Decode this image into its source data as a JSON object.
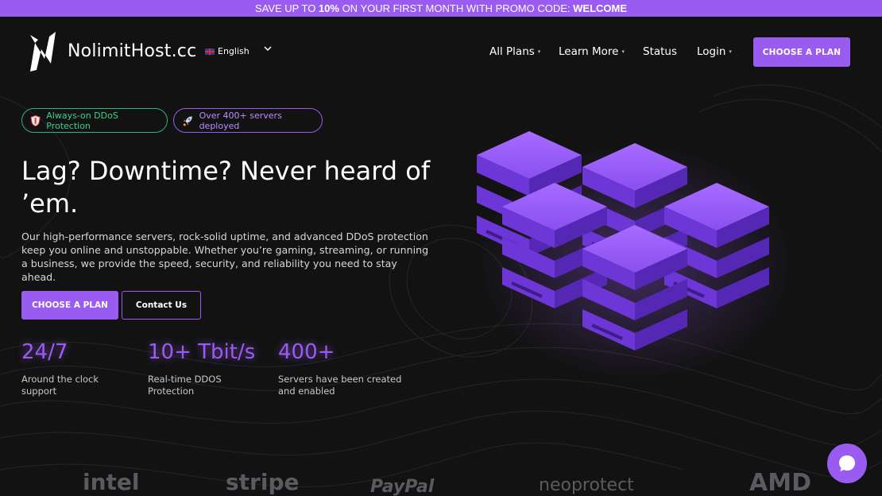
{
  "promo": {
    "prefix": "SAVE UP TO ",
    "discount": "10%",
    "middle": " ON YOUR FIRST MONTH WITH PROMO CODE: ",
    "code": "WELCOME"
  },
  "brand": {
    "name": "NolimitHost.cc"
  },
  "language": {
    "selected": "English"
  },
  "nav": {
    "items": [
      {
        "label": "All Plans",
        "has_dropdown": true
      },
      {
        "label": "Learn More",
        "has_dropdown": true
      },
      {
        "label": "Status",
        "has_dropdown": false
      },
      {
        "label": "Login",
        "has_dropdown": true
      }
    ],
    "cta": "CHOOSE A PLAN"
  },
  "badges": [
    {
      "label": "Always-on DDoS Protection",
      "icon": "shield-icon",
      "color": "#3ed08c"
    },
    {
      "label": "Over 400+ servers deployed",
      "icon": "rocket-icon",
      "color": "#b98cff"
    }
  ],
  "hero": {
    "headline": "Lag? Downtime? Never heard of ’em.",
    "description": "Our high-performance servers, rock-solid uptime, and advanced DDoS protection keep you online and unstoppable. Whether you’re gaming, streaming, or running a business, we provide the speed, security, and reliability you need to stay ahead.",
    "primary_button": "CHOOSE A PLAN",
    "secondary_button": "Contact Us"
  },
  "stats": [
    {
      "value": "24/7",
      "label": "Around the clock support"
    },
    {
      "value": "10+ Tbit/s",
      "label": "Real-time DDOS Protection"
    },
    {
      "value": "400+",
      "label": "Servers have been created and enabled"
    }
  ],
  "partners": [
    "intel",
    "stripe",
    "PayPal",
    "neoprotect",
    "AMD"
  ],
  "colors": {
    "accent": "#9a5cf0",
    "background": "#121212",
    "success": "#3ed08c"
  }
}
